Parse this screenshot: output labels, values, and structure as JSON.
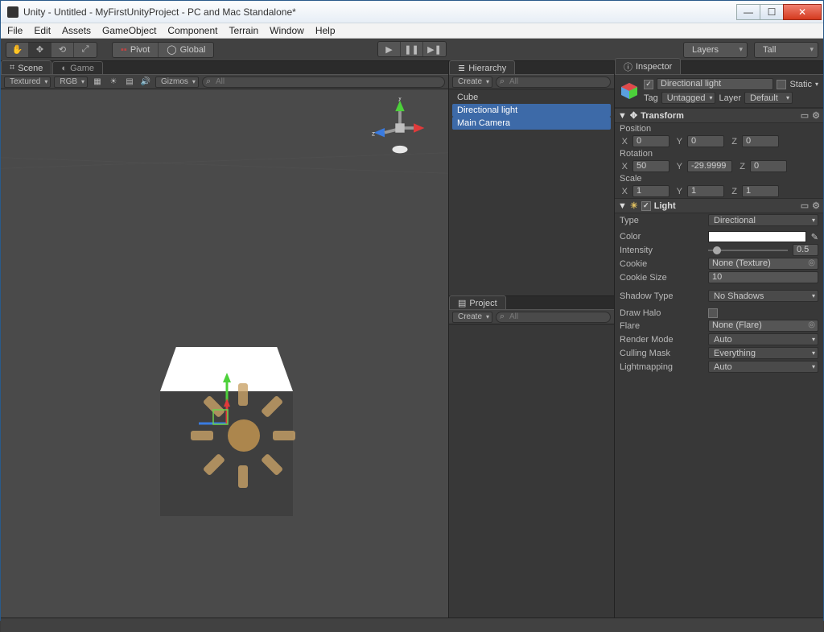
{
  "window": {
    "title": "Unity - Untitled - MyFirstUnityProject - PC and Mac Standalone*"
  },
  "menu": [
    "File",
    "Edit",
    "Assets",
    "GameObject",
    "Component",
    "Terrain",
    "Window",
    "Help"
  ],
  "toolbar": {
    "pivot": "Pivot",
    "global": "Global",
    "layers": "Layers",
    "layout": "Tall"
  },
  "tabs": {
    "scene": "Scene",
    "game": "Game",
    "hierarchy": "Hierarchy",
    "project": "Project",
    "inspector": "Inspector"
  },
  "scene_bar": {
    "shading": "Textured",
    "render": "RGB",
    "gizmos": "Gizmos",
    "search_ph": "All"
  },
  "axes": {
    "x": "x",
    "y": "y",
    "z": "z"
  },
  "hierarchy": {
    "create": "Create",
    "search_ph": "All",
    "items": [
      {
        "label": "Cube",
        "selected": false
      },
      {
        "label": "Directional light",
        "selected": true
      },
      {
        "label": "Main Camera",
        "selected": true
      }
    ]
  },
  "project": {
    "create": "Create",
    "search_ph": "All"
  },
  "inspector": {
    "name": "Directional light",
    "static": "Static",
    "tag_label": "Tag",
    "tag_value": "Untagged",
    "layer_label": "Layer",
    "layer_value": "Default",
    "transform": {
      "title": "Transform",
      "position_label": "Position",
      "rotation_label": "Rotation",
      "scale_label": "Scale",
      "axes": {
        "x": "X",
        "y": "Y",
        "z": "Z"
      },
      "position": {
        "x": "0",
        "y": "0",
        "z": "0"
      },
      "rotation": {
        "x": "50",
        "y": "-29.9999",
        "z": "0"
      },
      "scale": {
        "x": "1",
        "y": "1",
        "z": "1"
      }
    },
    "light": {
      "title": "Light",
      "type_label": "Type",
      "type_value": "Directional",
      "color_label": "Color",
      "intensity_label": "Intensity",
      "intensity_value": "0.5",
      "cookie_label": "Cookie",
      "cookie_value": "None (Texture)",
      "cookie_size_label": "Cookie Size",
      "cookie_size_value": "10",
      "shadow_label": "Shadow Type",
      "shadow_value": "No Shadows",
      "draw_halo_label": "Draw Halo",
      "flare_label": "Flare",
      "flare_value": "None (Flare)",
      "render_label": "Render Mode",
      "render_value": "Auto",
      "culling_label": "Culling Mask",
      "culling_value": "Everything",
      "lightmap_label": "Lightmapping",
      "lightmap_value": "Auto"
    }
  }
}
